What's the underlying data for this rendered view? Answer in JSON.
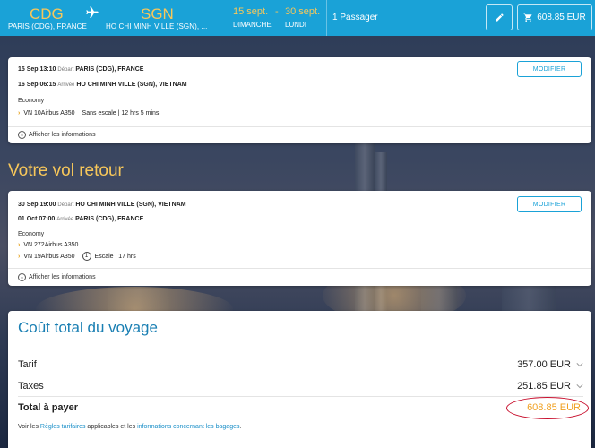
{
  "header": {
    "origin_code": "CDG",
    "origin_city": "PARIS (CDG), FRANCE",
    "dest_code": "SGN",
    "dest_city": "HO CHI MINH VILLE (SGN), ...",
    "depart_date": "15 sept.",
    "depart_day": "DIMANCHE",
    "date_separator": "-",
    "return_date": "30 sept.",
    "return_day": "LUNDI",
    "passengers": "1 Passager",
    "total_price": "608.85 EUR",
    "icons": {
      "plane": "plane-icon",
      "edit": "pencil-icon",
      "cart": "cart-icon"
    }
  },
  "outbound": {
    "depart_line": {
      "datetime": "15 Sep 13:10",
      "label": "Départ",
      "place": "PARIS (CDG), FRANCE"
    },
    "arrive_line": {
      "datetime": "16 Sep 06:15",
      "label": "Arrivée",
      "place": "HO CHI MINH VILLE (SGN), VIETNAM"
    },
    "cabin": "Economy",
    "segments": [
      {
        "flight": "VN 10Airbus A350",
        "detail": "Sans escale | 12 hrs 5 mins"
      }
    ],
    "modify_label": "MODIFIER",
    "info_label": "Afficher les informations"
  },
  "return_title": "Votre vol retour",
  "return": {
    "depart_line": {
      "datetime": "30 Sep 19:00",
      "label": "Départ",
      "place": "HO CHI MINH VILLE (SGN), VIETNAM"
    },
    "arrive_line": {
      "datetime": "01 Oct 07:00",
      "label": "Arrivée",
      "place": "PARIS (CDG), FRANCE"
    },
    "cabin": "Economy",
    "segments": [
      {
        "flight": "VN 272Airbus A350"
      },
      {
        "flight": "VN 19Airbus A350",
        "stops": "1",
        "detail": "Escale | 17 hrs"
      }
    ],
    "modify_label": "MODIFIER",
    "info_label": "Afficher les informations"
  },
  "cost": {
    "title": "Coût total du voyage",
    "rows": [
      {
        "label": "Tarif",
        "amount": "357.00 EUR"
      },
      {
        "label": "Taxes",
        "amount": "251.85 EUR"
      }
    ],
    "total_label": "Total à payer",
    "total_amount": "608.85 EUR",
    "footer": {
      "prefix": "Voir les ",
      "link1": "Règles tarifaires",
      "middle": " applicables et les ",
      "link2": "informations concernant les bagages",
      "suffix": "."
    }
  },
  "colors": {
    "header_bg": "#1aa2d7",
    "accent_gold": "#f7c75a",
    "link_blue": "#1a8fc8",
    "highlight_red": "#c8102e",
    "total_orange": "#f0a020"
  }
}
